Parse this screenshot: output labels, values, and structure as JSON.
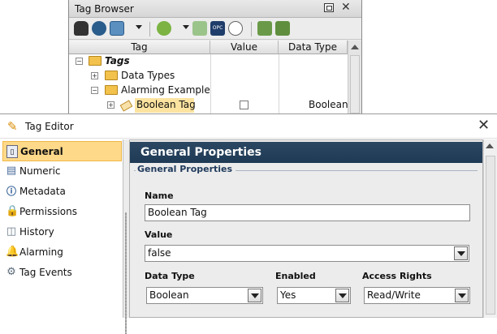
{
  "tag_browser": {
    "title": "Tag Browser",
    "columns": [
      "Tag",
      "Value",
      "Data Type"
    ],
    "tree": [
      {
        "label": "Tags",
        "italic_bold": true
      },
      {
        "label": "Data Types"
      },
      {
        "label": "Alarming Example"
      },
      {
        "label": "Boolean Tag",
        "value": "",
        "data_type": "Boolean"
      }
    ]
  },
  "tag_editor": {
    "title": "Tag Editor",
    "sidebar": [
      {
        "label": "General",
        "icon": "general-icon"
      },
      {
        "label": "Numeric",
        "icon": "numeric-icon"
      },
      {
        "label": "Metadata",
        "icon": "info-icon"
      },
      {
        "label": "Permissions",
        "icon": "lock-icon"
      },
      {
        "label": "History",
        "icon": "history-icon"
      },
      {
        "label": "Alarming",
        "icon": "bell-icon"
      },
      {
        "label": "Tag Events",
        "icon": "gears-icon"
      }
    ],
    "section_banner": "General Properties",
    "group_title": "General Properties",
    "fields": {
      "name_label": "Name",
      "name_value": "Boolean Tag",
      "value_label": "Value",
      "value_value": "false",
      "data_type_label": "Data Type",
      "data_type_value": "Boolean",
      "enabled_label": "Enabled",
      "enabled_value": "Yes",
      "access_label": "Access Rights",
      "access_value": "Read/Write"
    }
  }
}
